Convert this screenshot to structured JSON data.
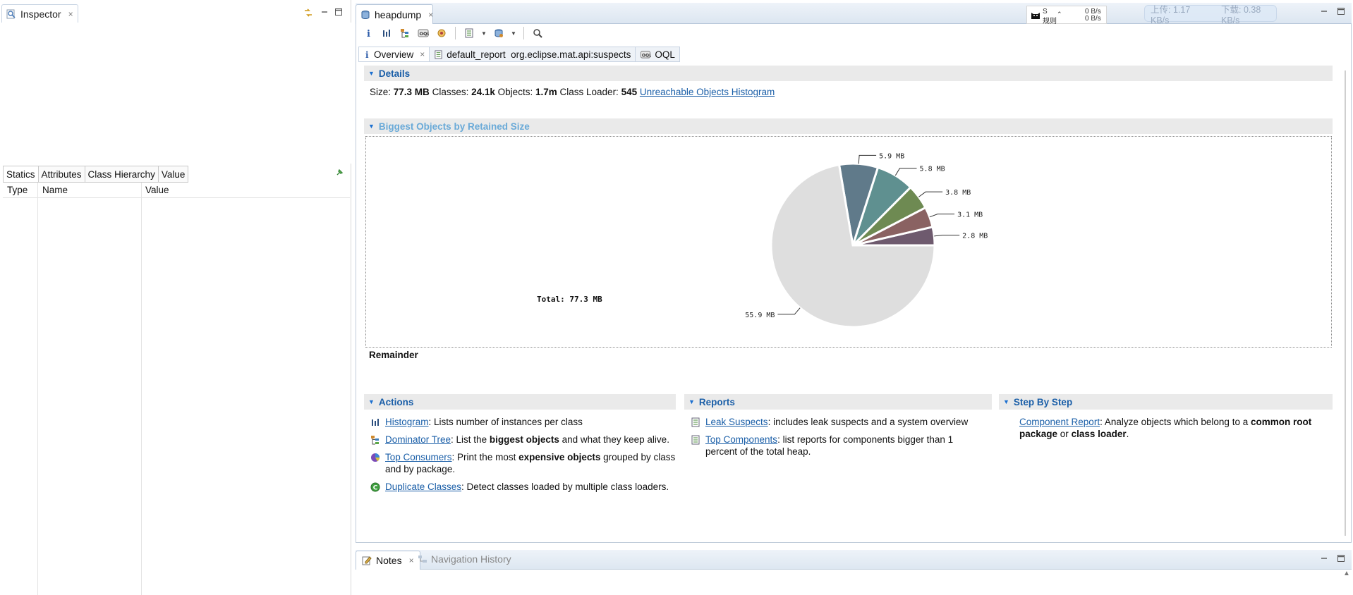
{
  "inspector": {
    "tab_label": "Inspector",
    "close_glyph": "×",
    "subtabs": [
      "Statics",
      "Attributes",
      "Class Hierarchy",
      "Value"
    ],
    "columns": [
      "Type",
      "Name",
      "Value"
    ]
  },
  "editor": {
    "tab_label": "heapdump",
    "close_glyph": "×",
    "net_widget": {
      "name": "S",
      "sub": "规则",
      "up": "0 B/s",
      "down": "0 B/s"
    },
    "speed_overlay": {
      "upload": "上传: 1.17 KB/s",
      "download": "下载: 0.38 KB/s"
    },
    "toolbar_icons": [
      "info-icon",
      "histogram-icon",
      "dominator-tree-icon",
      "oql-icon",
      "thread-icon",
      "report-icon",
      "dropdown-icon",
      "queries-icon",
      "dropdown-icon",
      "search-icon"
    ],
    "query_tabs": [
      {
        "label": "Overview",
        "icon": "info-icon",
        "closable": true
      },
      {
        "label": "default_report  org.eclipse.mat.api:suspects",
        "icon": "report-icon",
        "closable": false
      },
      {
        "label": "OQL",
        "icon": "oql-icon",
        "closable": false
      }
    ]
  },
  "details": {
    "heading": "Details",
    "size_label": "Size:",
    "size_value": "77.3 MB",
    "classes_label": "Classes:",
    "classes_value": "24.1k",
    "objects_label": "Objects:",
    "objects_value": "1.7m",
    "loader_label": "Class Loader:",
    "loader_value": "545",
    "unreachable_link": "Unreachable Objects Histogram"
  },
  "biggest": {
    "heading": "Biggest Objects by Retained Size",
    "remainder_label": "Remainder"
  },
  "chart_data": {
    "type": "pie",
    "title": "",
    "total_label": "Total: 77.3 MB",
    "slices": [
      {
        "label": "2.8 MB",
        "value": 2.8,
        "color": "#6e5a6e"
      },
      {
        "label": "3.1 MB",
        "value": 3.1,
        "color": "#8a6262"
      },
      {
        "label": "3.8 MB",
        "value": 3.8,
        "color": "#6e8a52"
      },
      {
        "label": "5.8 MB",
        "value": 5.8,
        "color": "#5f9090"
      },
      {
        "label": "5.9 MB",
        "value": 5.9,
        "color": "#607a8a"
      },
      {
        "label": "55.9 MB",
        "value": 55.9,
        "color": "#dedede"
      }
    ]
  },
  "actions": {
    "heading": "Actions",
    "items": [
      {
        "icon": "histogram-icon",
        "link": "Histogram",
        "text": ": Lists number of instances per class"
      },
      {
        "icon": "dominator-tree-icon",
        "link": "Dominator Tree",
        "text_a": ": List the ",
        "bold_a": "biggest objects",
        "text_b": " and what they keep alive."
      },
      {
        "icon": "top-consumers-icon",
        "link": "Top Consumers",
        "text_a": ": Print the most ",
        "bold_a": "expensive objects",
        "text_b": " grouped by class and by package."
      },
      {
        "icon": "duplicate-classes-icon",
        "link": "Duplicate Classes",
        "text": ": Detect classes loaded by multiple class loaders."
      }
    ]
  },
  "reports": {
    "heading": "Reports",
    "items": [
      {
        "icon": "report-icon",
        "link": "Leak Suspects",
        "text": ": includes leak suspects and a system overview"
      },
      {
        "icon": "report-icon",
        "link": "Top Components",
        "text": ": list reports for components bigger than 1 percent of the total heap."
      }
    ]
  },
  "step_by_step": {
    "heading": "Step By Step",
    "link": "Component Report",
    "text_a": ": Analyze objects which belong to a ",
    "bold_a": "common root package",
    "text_b": " or ",
    "bold_b": "class loader",
    "text_c": "."
  },
  "notes": {
    "tab_label": "Notes",
    "close_glyph": "×",
    "nav_history_label": "Navigation History"
  }
}
